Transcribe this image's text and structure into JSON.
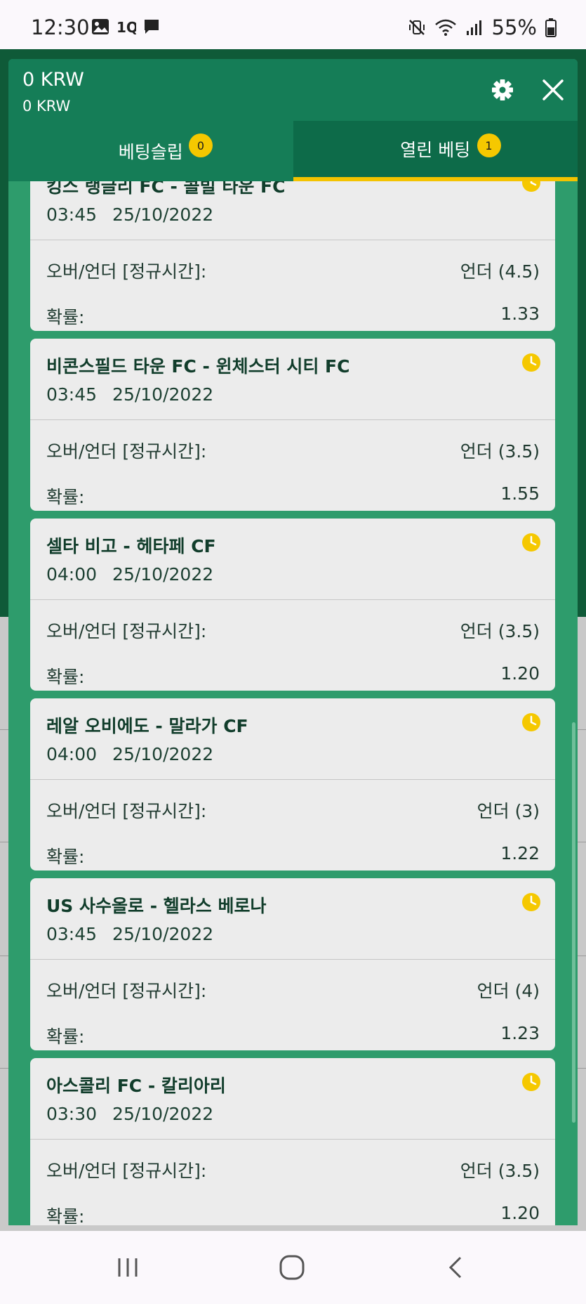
{
  "status_bar": {
    "time": "12:30",
    "battery": "55%",
    "left_icons": [
      "gallery-icon",
      "app-1q-icon",
      "chat-icon"
    ],
    "right_icons": [
      "vibrate-icon",
      "wifi-icon",
      "signal-icon",
      "battery-icon"
    ]
  },
  "header": {
    "balance": "0 KRW",
    "balance_sub": "0 KRW"
  },
  "tabs": [
    {
      "label": "베팅슬립",
      "badge": "0",
      "active": false
    },
    {
      "label": "열린 베팅",
      "badge": "1",
      "active": true
    }
  ],
  "bets": [
    {
      "match": "킹스 랭글리 FC - 콜빌 타운 FC",
      "time": "03:45",
      "date": "25/10/2022",
      "market_label": "오버/언더 [정규시간]:",
      "selection": "언더 (4.5)",
      "odds_label": "확률:",
      "odds": "1.33"
    },
    {
      "match": "비콘스필드 타운 FC - 윈체스터 시티 FC",
      "time": "03:45",
      "date": "25/10/2022",
      "market_label": "오버/언더 [정규시간]:",
      "selection": "언더 (3.5)",
      "odds_label": "확률:",
      "odds": "1.55"
    },
    {
      "match": "셀타 비고 - 헤타페 CF",
      "time": "04:00",
      "date": "25/10/2022",
      "market_label": "오버/언더 [정규시간]:",
      "selection": "언더 (3.5)",
      "odds_label": "확률:",
      "odds": "1.20"
    },
    {
      "match": "레알 오비에도 - 말라가 CF",
      "time": "04:00",
      "date": "25/10/2022",
      "market_label": "오버/언더 [정규시간]:",
      "selection": "언더 (3)",
      "odds_label": "확률:",
      "odds": "1.22"
    },
    {
      "match": "US 사수올로 - 헬라스 베로나",
      "time": "03:45",
      "date": "25/10/2022",
      "market_label": "오버/언더 [정규시간]:",
      "selection": "언더 (4)",
      "odds_label": "확률:",
      "odds": "1.23"
    },
    {
      "match": "아스콜리 FC - 칼리아리",
      "time": "03:30",
      "date": "25/10/2022",
      "market_label": "오버/언더 [정규시간]:",
      "selection": "언더 (3.5)",
      "odds_label": "확률:",
      "odds": "1.20"
    }
  ],
  "colors": {
    "header_green": "#157d57",
    "active_tab_green": "#0d6b49",
    "list_green": "#2e9c6c",
    "accent_yellow": "#f5c800",
    "card_bg": "#ececec"
  },
  "nav_icons": [
    "recent-apps-icon",
    "home-icon",
    "back-icon"
  ]
}
